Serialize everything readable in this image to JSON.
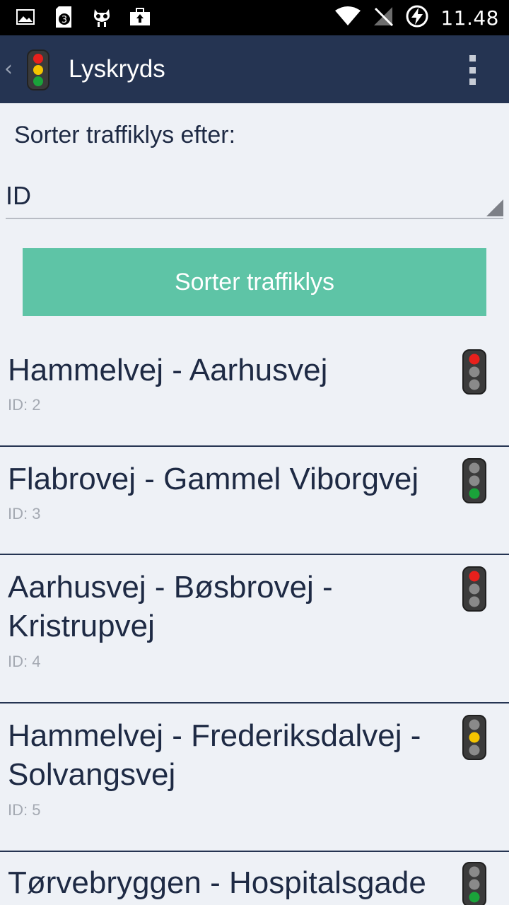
{
  "status_bar": {
    "time": "11.48",
    "left_icons": [
      "image-icon",
      "sd-card-3-icon",
      "cyanogen-mod-icon",
      "briefcase-upload-icon"
    ],
    "right_icons": [
      "wifi-icon",
      "no-signal-icon",
      "battery-charging-icon"
    ],
    "sd_badge": "3"
  },
  "action_bar": {
    "title": "Lyskryds",
    "back_glyph": "‹"
  },
  "sort": {
    "label": "Sorter traffiklys efter:",
    "selected": "ID",
    "button_label": "Sorter traffiklys"
  },
  "colors": {
    "accent": "#5ec4a6",
    "action_bar": "#253452",
    "background": "#eef1f6",
    "light_red": "#e8201c",
    "light_yellow": "#f4c400",
    "light_green": "#1aa33a",
    "light_off": "#8a8a8a"
  },
  "intersections": [
    {
      "name": "Hammelvej - Aarhusvej",
      "id_text": "ID: 2",
      "light": "red"
    },
    {
      "name": "Flabrovej - Gammel Viborgvej",
      "id_text": "ID: 3",
      "light": "green"
    },
    {
      "name": "Aarhusvej - Bøsbrovej - Kristrupvej",
      "id_text": "ID: 4",
      "light": "red"
    },
    {
      "name": "Hammelvej - Frederiksdalvej - Solvangsvej",
      "id_text": "ID: 5",
      "light": "yellow"
    },
    {
      "name": "Tørvebryggen - Hospitalsgade",
      "id_text": "",
      "light": "green"
    }
  ]
}
